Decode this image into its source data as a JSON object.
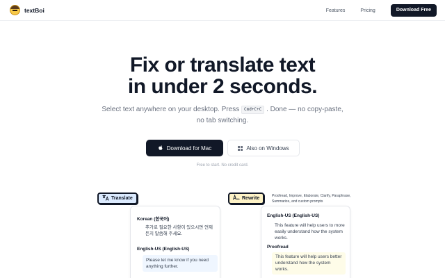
{
  "header": {
    "brand": "textBoi",
    "nav": [
      "Features",
      "Pricing"
    ],
    "cta": "Download Free"
  },
  "hero": {
    "title_line1": "Fix or translate text",
    "title_line2": "in under 2 seconds.",
    "subtitle_before": "Select text anywhere on your desktop. Press",
    "shortcut": "Cmd+C+C",
    "subtitle_after": ". Done — no copy-paste, no tab switching.",
    "primary_button": "Download for Mac",
    "secondary_button": "Also on Windows",
    "note": "Free to start. No credit card."
  },
  "translate_card": {
    "tag": "Translate",
    "source_label": "Korean (한국어)",
    "source_text": "추가로 필요한 사항이 있으시면 언제든지 말씀해 주세요.",
    "target_label": "English-US (English-US)",
    "target_text": "Please let me know if you need anything further."
  },
  "rewrite_card": {
    "tag": "Rewrite",
    "tag_description": "Proofread, Improve, Elaborate, Clarify, Paraphrase, Summarize, and custom prompts",
    "source_label": "English-US (English-US)",
    "source_text": "This feature will help users to more easily understand how the system works.",
    "result_label": "Proofread",
    "result_text": "This feature will help users better understand how the system works."
  },
  "colors": {
    "primary": "#111827",
    "translate_tag": "#dbeafe",
    "rewrite_tag": "#fef3c7"
  },
  "icons": {
    "brand": "emoji-face-icon",
    "mac": "apple-icon",
    "windows": "windows-icon",
    "translate": "translate-icon",
    "rewrite": "rewrite-icon"
  }
}
